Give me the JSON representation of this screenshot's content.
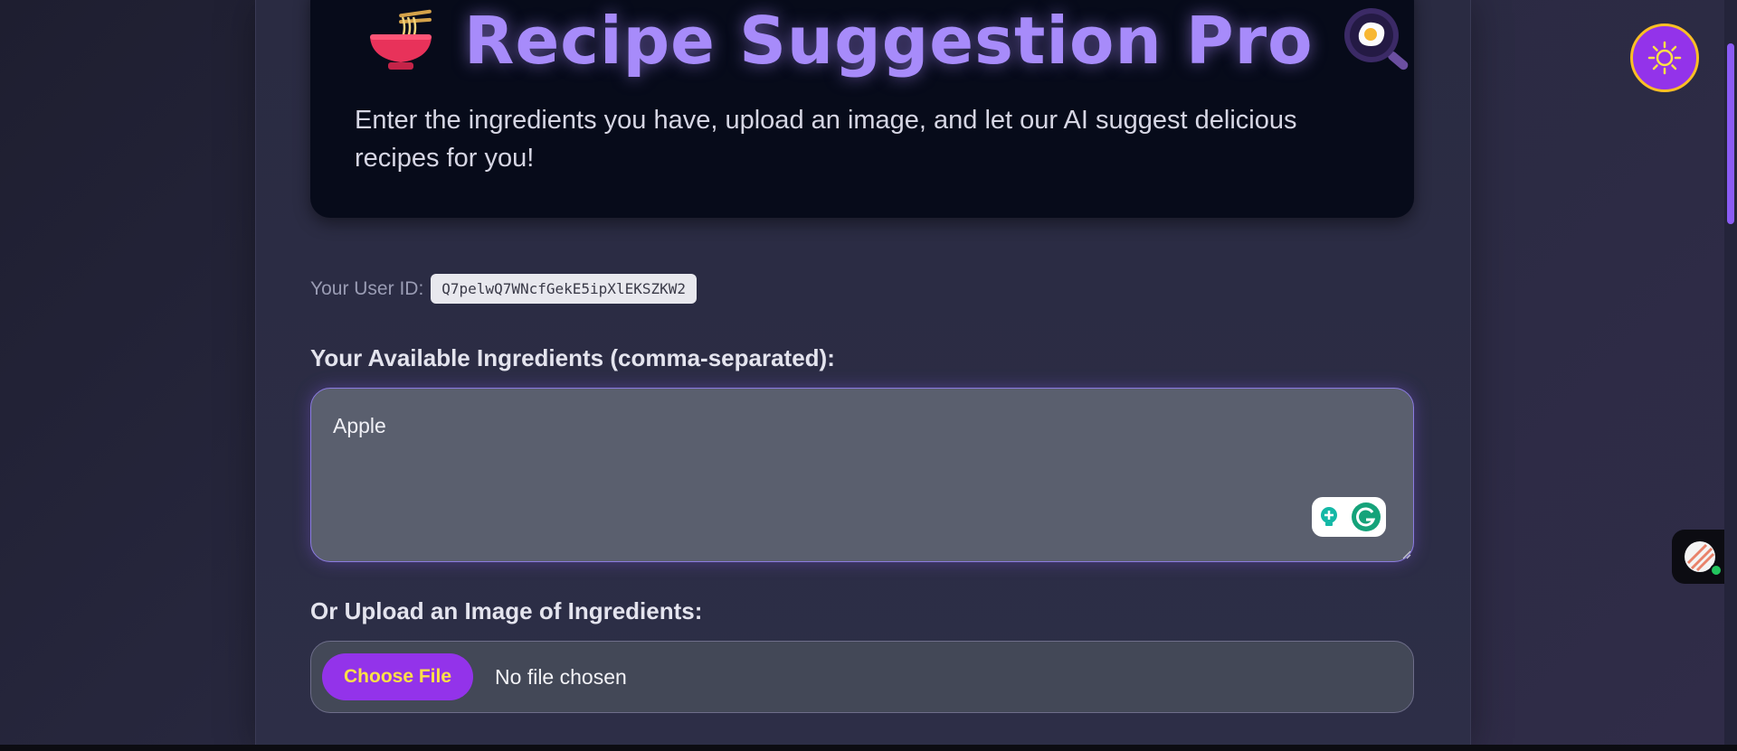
{
  "header": {
    "title": "Recipe Suggestion Pro",
    "subtitle": "Enter the ingredients you have, upload an image, and let our AI suggest delicious recipes for you!",
    "left_emoji_icon": "noodle-bowl-icon",
    "right_emoji_icon": "frying-pan-egg-icon"
  },
  "user": {
    "label": "Your User ID:",
    "id": "Q7pelwQ7WNcfGekE5ipXlEKSZKW2"
  },
  "ingredients": {
    "label": "Your Available Ingredients (comma-separated):",
    "value": "Apple"
  },
  "upload": {
    "label": "Or Upload an Image of Ingredients:",
    "button_label": "Choose File",
    "status": "No file chosen"
  },
  "colors": {
    "accent": "#a78bfa",
    "button": "#9333ea",
    "button_text": "#fde047",
    "toggle_border": "#fbbf24"
  }
}
